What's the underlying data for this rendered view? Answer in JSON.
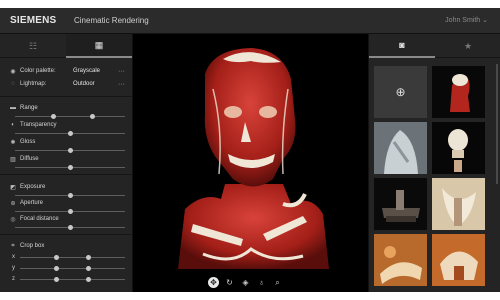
{
  "header": {
    "logo": "SIEMENS",
    "title": "Cinematic Rendering",
    "user": "John Smith ⌄"
  },
  "left_panel": {
    "tabs": [
      {
        "icon": "sliders-icon",
        "glyph": "☷"
      },
      {
        "icon": "grid-icon",
        "glyph": "▦"
      }
    ],
    "active_tab": 1,
    "settings": [
      {
        "label": "Color palette:",
        "value": "Grayscale",
        "icon": "palette-icon",
        "glyph": "◉"
      },
      {
        "label": "Lightmap:",
        "value": "Outdoor",
        "icon": "bulb-icon",
        "glyph": "◌"
      }
    ],
    "more_glyph": "···",
    "sliders": [
      {
        "label": "Range",
        "icon": "range-icon",
        "glyph": "▬",
        "knobs": [
          0.35,
          0.7
        ]
      },
      {
        "label": "Transparency",
        "icon": "transparency-icon",
        "glyph": "◐",
        "knobs": [
          0.5
        ]
      },
      {
        "label": "Gloss",
        "icon": "gloss-icon",
        "glyph": "✺",
        "knobs": [
          0.5
        ]
      },
      {
        "label": "Diffuse",
        "icon": "diffuse-icon",
        "glyph": "▨",
        "knobs": [
          0.5
        ]
      },
      {
        "label": "Exposure",
        "icon": "exposure-icon",
        "glyph": "◩",
        "knobs": [
          0.5
        ]
      },
      {
        "label": "Aperture",
        "icon": "aperture-icon",
        "glyph": "⊛",
        "knobs": [
          0.5
        ]
      },
      {
        "label": "Focal distance",
        "icon": "focal-icon",
        "glyph": "◎",
        "knobs": [
          0.5
        ]
      }
    ],
    "crop_box": {
      "label": "Crop box",
      "icon": "crop-icon",
      "glyph": "⌗",
      "axes": [
        {
          "name": "x",
          "knobs": [
            0.35,
            0.65
          ]
        },
        {
          "name": "y",
          "knobs": [
            0.35,
            0.65
          ]
        },
        {
          "name": "z",
          "knobs": [
            0.35,
            0.65
          ]
        }
      ]
    }
  },
  "viewport": {
    "subject": "anatomical head rendering",
    "tools": [
      {
        "icon": "move-icon",
        "glyph": "✥",
        "active": true
      },
      {
        "icon": "rotate-icon",
        "glyph": "↻",
        "active": false
      },
      {
        "icon": "layers-icon",
        "glyph": "◈",
        "active": false
      },
      {
        "icon": "light-icon",
        "glyph": "♁",
        "active": false
      },
      {
        "icon": "zoom-icon",
        "glyph": "⌕",
        "active": false
      }
    ]
  },
  "right_panel": {
    "tabs": [
      {
        "icon": "camera-icon",
        "glyph": "◙"
      },
      {
        "icon": "star-icon",
        "glyph": "★"
      }
    ],
    "active_tab": 0,
    "add_snapshot_glyph": "⊕",
    "thumbnails": [
      {
        "name": "thumb-red-head"
      },
      {
        "name": "thumb-gray-neck"
      },
      {
        "name": "thumb-skull"
      },
      {
        "name": "thumb-dark-spine"
      },
      {
        "name": "thumb-spine-light"
      },
      {
        "name": "thumb-orange-bone"
      },
      {
        "name": "thumb-orange-skull"
      }
    ]
  },
  "colors": {
    "background": "#1c1c1c",
    "panel": "#242424",
    "header": "#2b2b2b",
    "flesh": "#b3261e",
    "bone": "#efe6d6"
  }
}
